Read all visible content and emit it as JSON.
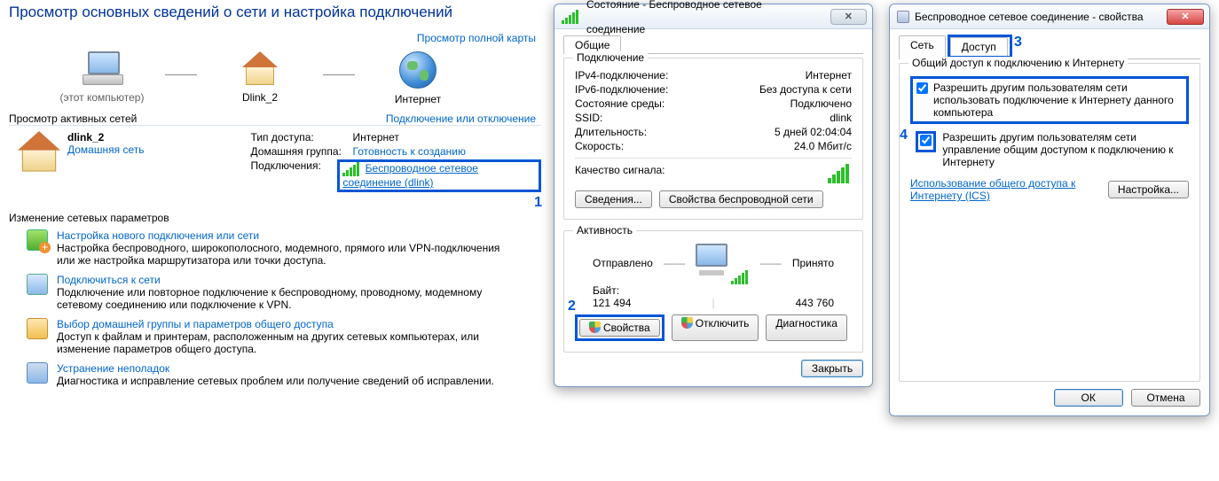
{
  "ns": {
    "title": "Просмотр основных сведений о сети и настройка подключений",
    "mapview": "Просмотр полной карты",
    "nodes": {
      "pc": "",
      "pc_below": "(этот компьютер)",
      "router": "Dlink_2",
      "internet": "Интернет"
    },
    "active_hdr": "Просмотр активных сетей",
    "active_link_right": "Подключение или отключение",
    "active": {
      "name": "dlink_2",
      "type": "Домашняя сеть",
      "access_type_k": "Тип доступа:",
      "access_type_v": "Интернет",
      "homegroup_k": "Домашняя группа:",
      "homegroup_v": "Готовность к созданию",
      "conn_k": "Подключения:",
      "conn_v": "Беспроводное сетевое соединение (dlink)"
    },
    "settings_title": "Изменение сетевых параметров",
    "tasks": {
      "t1": "Настройка нового подключения или сети",
      "t1d": "Настройка беспроводного, широкополосного, модемного, прямого или VPN-подключения или же настройка маршрутизатора или точки доступа.",
      "t2": "Подключиться к сети",
      "t2d": "Подключение или повторное подключение к беспроводному, проводному, модемному сетевому соединению или подключение к VPN.",
      "t3": "Выбор домашней группы и параметров общего доступа",
      "t3d": "Доступ к файлам и принтерам, расположенным на других сетевых компьютерах, или изменение параметров общего доступа.",
      "t4": "Устранение неполадок",
      "t4d": "Диагностика и исправление сетевых проблем или получение сведений об исправлении."
    },
    "step1": "1"
  },
  "status": {
    "title": "Состояние - Беспроводное сетевое соединение",
    "tab": "Общие",
    "grp_conn": "Подключение",
    "ipv4_k": "IPv4-подключение:",
    "ipv4_v": "Интернет",
    "ipv6_k": "IPv6-подключение:",
    "ipv6_v": "Без доступа к сети",
    "media_k": "Состояние среды:",
    "media_v": "Подключено",
    "ssid_k": "SSID:",
    "ssid_v": "dlink",
    "dur_k": "Длительность:",
    "dur_v": "5 дней 02:04:04",
    "speed_k": "Скорость:",
    "speed_v": "24.0 Мбит/с",
    "sig_k": "Качество сигнала:",
    "btn_details": "Сведения...",
    "btn_wprops": "Свойства беспроводной сети",
    "grp_act": "Активность",
    "sent": "Отправлено",
    "recv": "Принято",
    "bytes_k": "Байт:",
    "bytes_sent": "121 494",
    "bytes_recv": "443 760",
    "btn_props": "Свойства",
    "btn_disable": "Отключить",
    "btn_diag": "Диагностика",
    "btn_close": "Закрыть",
    "step2": "2"
  },
  "props": {
    "title": "Беспроводное сетевое соединение - свойства",
    "tab_net": "Сеть",
    "tab_share": "Доступ",
    "grp": "Общий доступ к подключению к Интернету",
    "chk1": "Разрешить другим пользователям сети использовать подключение к Интернету данного компьютера",
    "chk2": "Разрешить другим пользователям сети управление общим доступом к подключению к Интернету",
    "ics": "Использование общего доступа к Интернету (ICS)",
    "btn_settings": "Настройка...",
    "btn_ok": "ОК",
    "btn_cancel": "Отмена",
    "step3": "3",
    "step4": "4"
  }
}
